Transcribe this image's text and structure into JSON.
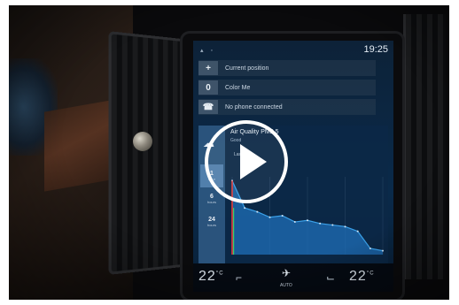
{
  "screen": {
    "clock": "19:25",
    "rows": [
      {
        "icon": "navigation-icon",
        "glyph": "+",
        "label": "Current position"
      },
      {
        "icon": "media-icon",
        "glyph": "0",
        "label": "Color Me"
      },
      {
        "icon": "phone-icon",
        "glyph": "☎",
        "label": "No phone connected"
      }
    ],
    "air_quality": {
      "title": "Air Quality PM2.5",
      "subtitle": "Good",
      "range_label": "Last hour",
      "tabs": [
        {
          "value": "1",
          "unit": "hour"
        },
        {
          "value": "6",
          "unit": "hours"
        },
        {
          "value": "24",
          "unit": "hours"
        }
      ],
      "chart_data": {
        "type": "area",
        "x": [
          0,
          1,
          2,
          3,
          4,
          5,
          6,
          7,
          8,
          9,
          10,
          11,
          12
        ],
        "series": [
          {
            "values": [
              95,
              60,
              55,
              48,
              50,
              42,
              44,
              40,
              38,
              36,
              30,
              8,
              5
            ]
          }
        ],
        "ylim": [
          0,
          100
        ],
        "grid": true,
        "highlight_color": "#e23a3a",
        "line_color": "#3aa0e8",
        "fill_color": "#1f6fb8"
      }
    },
    "climate": {
      "left_temp": "22",
      "right_temp": "22",
      "unit": "°C",
      "auto_label": "AUTO"
    }
  },
  "colors": {
    "screen_bg": "#0a2a4a",
    "accent": "#3aa0e8",
    "play_button": "#ffffff"
  }
}
